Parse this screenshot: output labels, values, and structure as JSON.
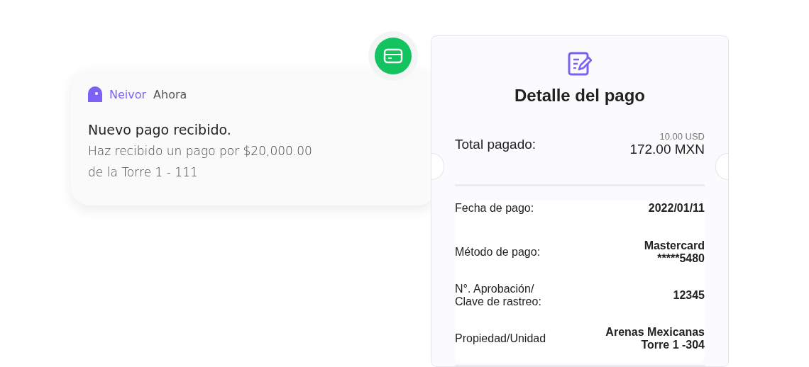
{
  "notification": {
    "app": "Neivor",
    "time": "Ahora",
    "title": "Nuevo pago recibido.",
    "body_lines": [
      "Haz recibido un pago por $20,000.00",
      "de la Torre 1 - 111"
    ]
  },
  "receipt": {
    "title": "Detalle del pago",
    "total_label": "Total pagado:",
    "total_secondary": "10.00 USD",
    "total_primary": "172.00 MXN",
    "details": [
      {
        "label_lines": [
          "Fecha de pago:"
        ],
        "value_lines": [
          "2022/01/11"
        ]
      },
      {
        "label_lines": [
          "Método de pago:"
        ],
        "value_lines": [
          "Mastercard",
          "*****5480"
        ]
      },
      {
        "label_lines": [
          "N°. Aprobación/",
          "Clave de rastreo:"
        ],
        "value_lines": [
          "12345"
        ]
      },
      {
        "label_lines": [
          "Propiedad/Unidad"
        ],
        "value_lines": [
          "Arenas Mexicanas",
          "Torre 1 -304"
        ]
      }
    ]
  }
}
